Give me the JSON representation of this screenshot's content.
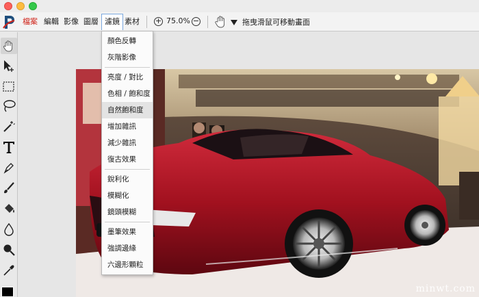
{
  "window": {
    "traffic_lights": [
      "close",
      "minimize",
      "zoom"
    ]
  },
  "menubar": {
    "items": [
      "檔案",
      "編輯",
      "影像",
      "圖層",
      "濾鏡",
      "素材"
    ],
    "zoom_value": "75.0%",
    "zoom_in": "+",
    "zoom_out": "−",
    "hint": "拖曳滑鼠可移動畫面",
    "accent_color": "#d0271d"
  },
  "dropdown": {
    "groups": [
      [
        "顏色反轉",
        "灰階影像"
      ],
      [
        "亮度 / 對比",
        "色相 / 飽和度",
        "自然飽和度",
        "增加雜訊",
        "減少雜訊",
        "復古效果"
      ],
      [
        "銳利化",
        "模糊化",
        "鏡頭模糊"
      ],
      [
        "墨筆效果",
        "強調邊緣",
        "六邊形顆粒"
      ]
    ],
    "hovered": "自然飽和度"
  },
  "tools": [
    "hand-icon",
    "move-icon",
    "marquee-icon",
    "lasso-icon",
    "magic-wand-icon",
    "text-icon",
    "pen-icon",
    "brush-icon",
    "paint-bucket-icon",
    "drop-icon",
    "zoom-icon",
    "eyedropper-icon"
  ],
  "canvas": {
    "image_subject": "red-sports-car"
  },
  "watermark": "minwt.com"
}
